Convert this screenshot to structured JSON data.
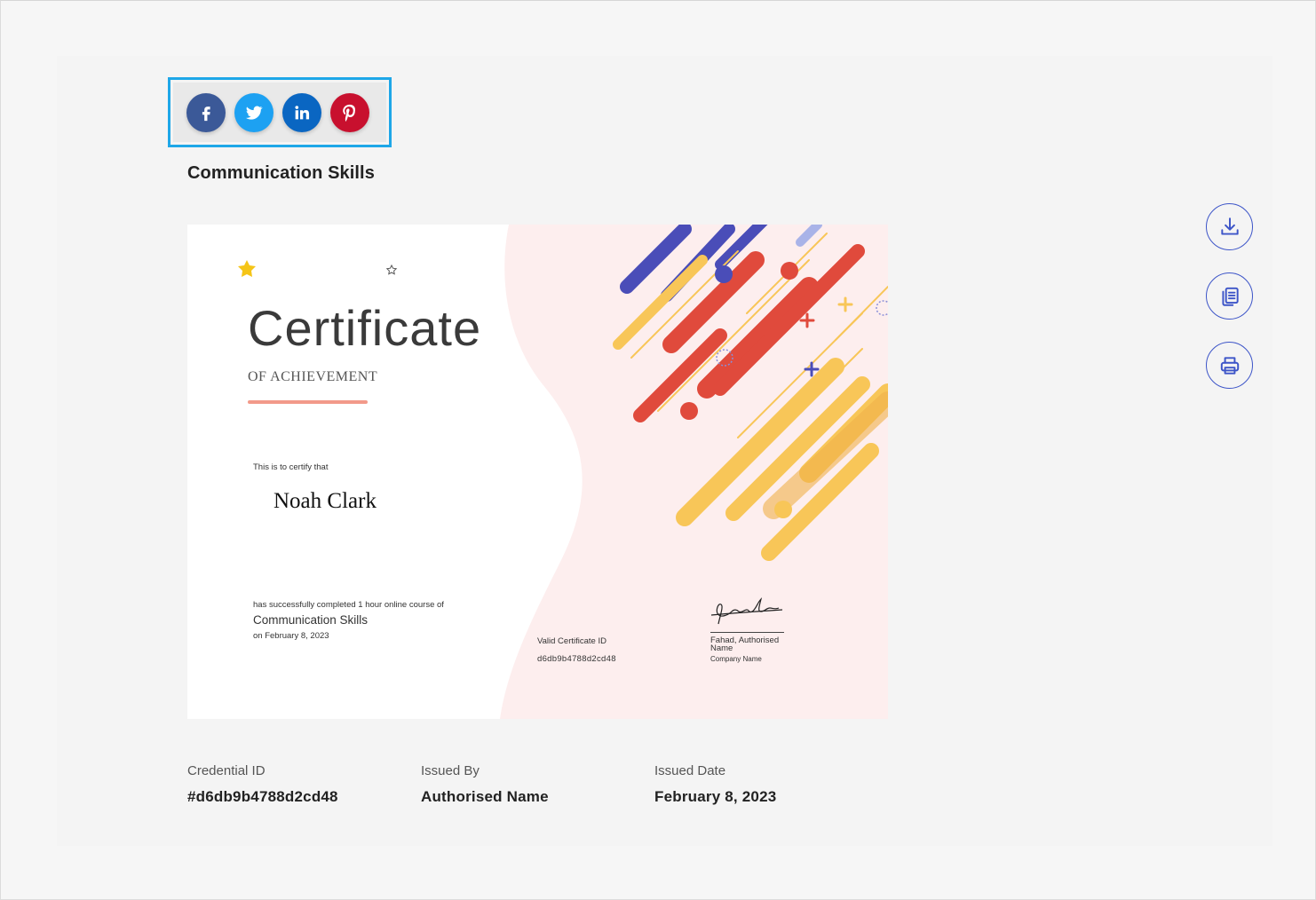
{
  "page": {
    "title": "Communication Skills"
  },
  "share": {
    "items": [
      {
        "name": "facebook",
        "icon": "facebook-icon",
        "color": "#3b5998"
      },
      {
        "name": "twitter",
        "icon": "twitter-icon",
        "color": "#1da1f2"
      },
      {
        "name": "linkedin",
        "icon": "linkedin-icon",
        "color": "#0a66c2"
      },
      {
        "name": "pinterest",
        "icon": "pinterest-icon",
        "color": "#c8102e"
      }
    ],
    "highlight_color": "#1ea7e8"
  },
  "certificate": {
    "heading": "Certificate",
    "subheading": "OF ACHIEVEMENT",
    "certify_text": "This is to certify that",
    "recipient": "Noah Clark",
    "completed_text": "has successfully completed 1 hour online course of",
    "course": "Communication Skills",
    "date_text": "on February 8, 2023",
    "valid_label": "Valid Certificate ID",
    "valid_id": "d6db9b4788d2cd48",
    "authoriser": "Fahad, Authorised Name",
    "company": "Company Name"
  },
  "actions": [
    {
      "name": "download",
      "icon": "download-icon"
    },
    {
      "name": "copy",
      "icon": "copy-icon"
    },
    {
      "name": "print",
      "icon": "print-icon"
    }
  ],
  "details": {
    "credential_label": "Credential ID",
    "credential_value": "#d6db9b4788d2cd48",
    "issued_by_label": "Issued By",
    "issued_by_value": "Authorised Name",
    "issued_date_label": "Issued Date",
    "issued_date_value": "February 8, 2023"
  },
  "colors": {
    "accent": "#3d55c8",
    "panel": "#f4f4f4"
  }
}
